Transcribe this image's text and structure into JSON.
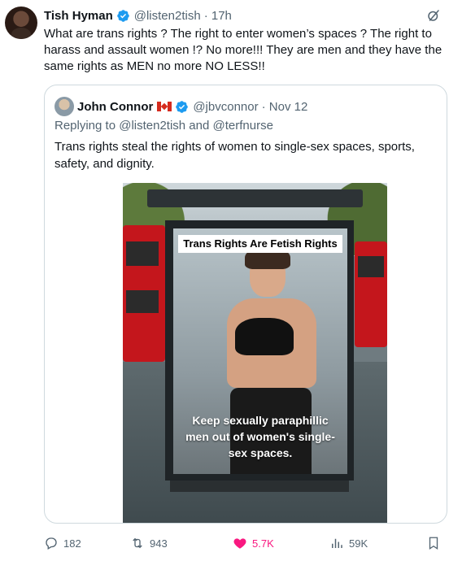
{
  "tweet": {
    "author_name": "Tish Hyman",
    "handle": "@listen2tish",
    "time": "· 17h",
    "text": "What are trans rights ? The right to enter women’s spaces ? The right to harass and assault women !? No more!!! They are men and they have the same rights as MEN no more NO LESS!!",
    "verified_color": "#1d9bf0"
  },
  "quoted": {
    "author_name": "John Connor",
    "flag": "🇨🇦",
    "handle": "@jbvconnor",
    "time": "· Nov 12",
    "replying_to": "Replying to @listen2tish and @terfnurse",
    "text": "Trans rights steal the rights of women to single-sex spaces, sports, safety, and dignity.",
    "image": {
      "ad_title": "Trans Rights Are Fetish Rights",
      "ad_slogan": "Keep sexually paraphillic men out of women's single-sex spaces."
    }
  },
  "actions": {
    "replies": "182",
    "retweets": "943",
    "likes": "5.7K",
    "views": "59K",
    "like_color": "#f91880"
  }
}
